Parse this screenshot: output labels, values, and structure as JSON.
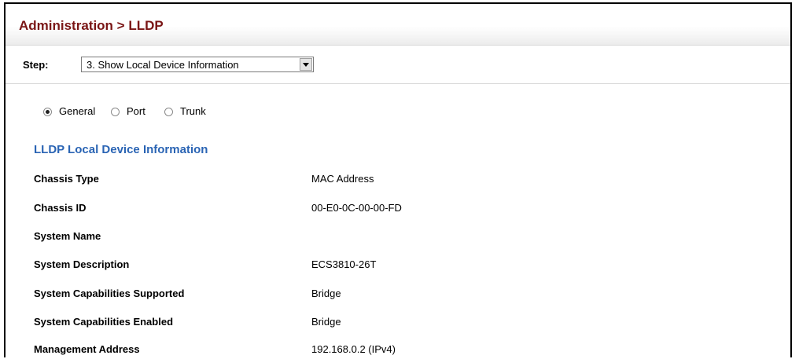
{
  "header": {
    "title": "Administration > LLDP"
  },
  "step": {
    "label": "Step:",
    "selected": "3. Show Local Device Information"
  },
  "view_options": [
    {
      "label": "General",
      "checked": true
    },
    {
      "label": "Port",
      "checked": false
    },
    {
      "label": "Trunk",
      "checked": false
    }
  ],
  "section": {
    "title": "LLDP Local Device Information"
  },
  "info": [
    {
      "label": "Chassis Type",
      "value": "MAC Address"
    },
    {
      "label": "Chassis ID",
      "value": "00-E0-0C-00-00-FD"
    },
    {
      "label": "System Name",
      "value": ""
    },
    {
      "label": "System Description",
      "value": "ECS3810-26T"
    },
    {
      "label": "System Capabilities Supported",
      "value": "Bridge"
    },
    {
      "label": "System Capabilities Enabled",
      "value": "Bridge"
    },
    {
      "label": "Management Address",
      "value": "192.168.0.2 (IPv4)"
    }
  ],
  "colors": {
    "title": "#7a1616",
    "section_title": "#2a64b4"
  }
}
